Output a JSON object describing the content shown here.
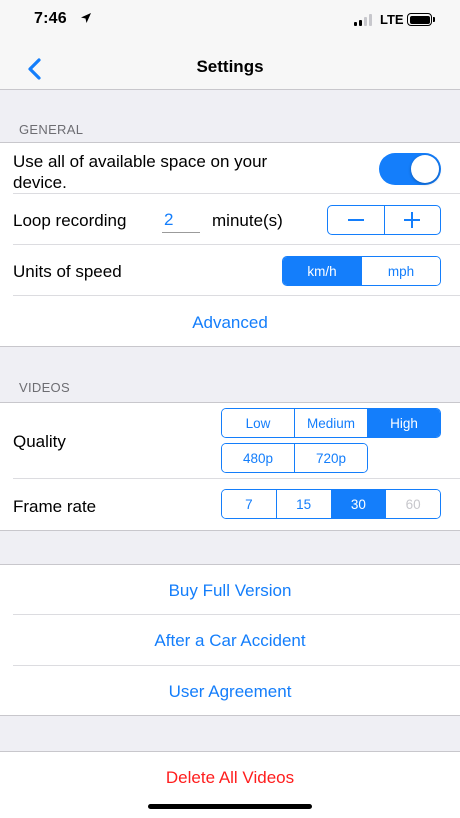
{
  "status": {
    "time": "7:46",
    "network": "LTE"
  },
  "nav": {
    "title": "Settings"
  },
  "general": {
    "header": "GENERAL",
    "use_space_label": "Use all of available space on your device.",
    "use_space_enabled": true,
    "loop_label": "Loop recording",
    "loop_value": "2",
    "loop_unit": "minute(s)",
    "speed_label": "Units of speed",
    "speed_options": [
      "km/h",
      "mph"
    ],
    "speed_selected": "km/h",
    "advanced_label": "Advanced"
  },
  "videos": {
    "header": "VIDEOS",
    "quality_label": "Quality",
    "quality_options_row1": [
      "Low",
      "Medium",
      "High"
    ],
    "quality_options_row2": [
      "480p",
      "720p"
    ],
    "quality_selected": "High",
    "framerate_label": "Frame rate",
    "framerate_options": [
      "7",
      "15",
      "30",
      "60"
    ],
    "framerate_selected": "30",
    "framerate_disabled": "60"
  },
  "links": {
    "buy": "Buy Full Version",
    "accident": "After a Car Accident",
    "agreement": "User Agreement"
  },
  "danger": {
    "delete": "Delete All Videos"
  },
  "colors": {
    "accent": "#147efb",
    "danger": "#ff1d1d",
    "background": "#efeff4"
  }
}
